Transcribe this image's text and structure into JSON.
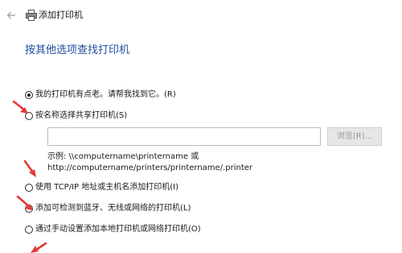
{
  "window": {
    "title": "添加打印机",
    "back_icon": "back-arrow-icon",
    "app_icon": "printer-icon"
  },
  "heading": "按其他选项查找打印机",
  "options": [
    {
      "label": "我的打印机有点老。请帮我找到它。(R)",
      "selected": true
    },
    {
      "label": "按名称选择共享打印机(S)",
      "selected": false
    },
    {
      "label": "使用 TCP/IP 地址或主机名添加打印机(I)",
      "selected": false
    },
    {
      "label": "添加可检测到蓝牙、无线或网络的打印机(L)",
      "selected": false
    },
    {
      "label": "通过手动设置添加本地打印机或网络打印机(O)",
      "selected": false
    }
  ],
  "shared_printer": {
    "input_value": "",
    "browse_label": "浏览(R)...",
    "example_line1": "示例: \\\\computername\\printername 或",
    "example_line2": "http://computername/printers/printername/.printer"
  },
  "colors": {
    "heading": "#1f4e9e",
    "annotation_arrow": "#e53935",
    "disabled_button_bg": "#e6e6e6",
    "disabled_button_text": "#9a9a9a"
  }
}
